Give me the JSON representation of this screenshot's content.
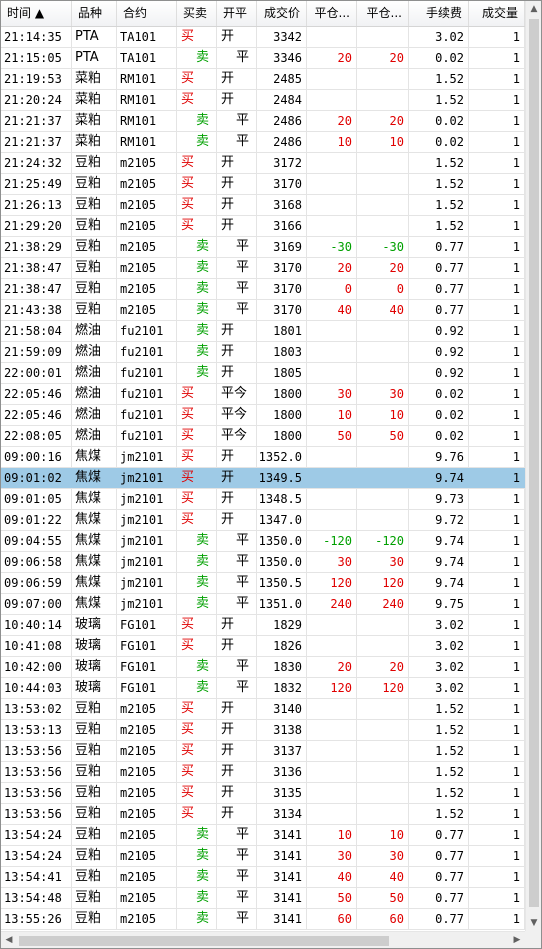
{
  "columns": [
    {
      "key": "time",
      "label": "时间 ▲"
    },
    {
      "key": "variety",
      "label": "品种"
    },
    {
      "key": "contract",
      "label": "合约"
    },
    {
      "key": "side",
      "label": "买卖"
    },
    {
      "key": "offset",
      "label": "开平"
    },
    {
      "key": "price",
      "label": "成交价"
    },
    {
      "key": "pnl1",
      "label": "平仓..."
    },
    {
      "key": "pnl2",
      "label": "平仓..."
    },
    {
      "key": "fee",
      "label": "手续费"
    },
    {
      "key": "qty",
      "label": "成交量"
    }
  ],
  "colors": {
    "buy": "#e00000",
    "sell": "#00a000",
    "selected_row": "#9ecae6"
  },
  "selected_index": 21,
  "rows": [
    {
      "time": "21:14:35",
      "variety": "PTA",
      "contract": "TA101",
      "side": "买",
      "offset": "开",
      "price": "3342",
      "pnl1": "",
      "pnl2": "",
      "fee": "3.02",
      "qty": "1"
    },
    {
      "time": "21:15:05",
      "variety": "PTA",
      "contract": "TA101",
      "side": "卖",
      "offset": "平",
      "price": "3346",
      "pnl1": "20",
      "pnl2": "20",
      "fee": "0.02",
      "qty": "1"
    },
    {
      "time": "21:19:53",
      "variety": "菜粕",
      "contract": "RM101",
      "side": "买",
      "offset": "开",
      "price": "2485",
      "pnl1": "",
      "pnl2": "",
      "fee": "1.52",
      "qty": "1"
    },
    {
      "time": "21:20:24",
      "variety": "菜粕",
      "contract": "RM101",
      "side": "买",
      "offset": "开",
      "price": "2484",
      "pnl1": "",
      "pnl2": "",
      "fee": "1.52",
      "qty": "1"
    },
    {
      "time": "21:21:37",
      "variety": "菜粕",
      "contract": "RM101",
      "side": "卖",
      "offset": "平",
      "price": "2486",
      "pnl1": "20",
      "pnl2": "20",
      "fee": "0.02",
      "qty": "1"
    },
    {
      "time": "21:21:37",
      "variety": "菜粕",
      "contract": "RM101",
      "side": "卖",
      "offset": "平",
      "price": "2486",
      "pnl1": "10",
      "pnl2": "10",
      "fee": "0.02",
      "qty": "1"
    },
    {
      "time": "21:24:32",
      "variety": "豆粕",
      "contract": "m2105",
      "side": "买",
      "offset": "开",
      "price": "3172",
      "pnl1": "",
      "pnl2": "",
      "fee": "1.52",
      "qty": "1"
    },
    {
      "time": "21:25:49",
      "variety": "豆粕",
      "contract": "m2105",
      "side": "买",
      "offset": "开",
      "price": "3170",
      "pnl1": "",
      "pnl2": "",
      "fee": "1.52",
      "qty": "1"
    },
    {
      "time": "21:26:13",
      "variety": "豆粕",
      "contract": "m2105",
      "side": "买",
      "offset": "开",
      "price": "3168",
      "pnl1": "",
      "pnl2": "",
      "fee": "1.52",
      "qty": "1"
    },
    {
      "time": "21:29:20",
      "variety": "豆粕",
      "contract": "m2105",
      "side": "买",
      "offset": "开",
      "price": "3166",
      "pnl1": "",
      "pnl2": "",
      "fee": "1.52",
      "qty": "1"
    },
    {
      "time": "21:38:29",
      "variety": "豆粕",
      "contract": "m2105",
      "side": "卖",
      "offset": "平",
      "price": "3169",
      "pnl1": "-30",
      "pnl2": "-30",
      "fee": "0.77",
      "qty": "1"
    },
    {
      "time": "21:38:47",
      "variety": "豆粕",
      "contract": "m2105",
      "side": "卖",
      "offset": "平",
      "price": "3170",
      "pnl1": "20",
      "pnl2": "20",
      "fee": "0.77",
      "qty": "1"
    },
    {
      "time": "21:38:47",
      "variety": "豆粕",
      "contract": "m2105",
      "side": "卖",
      "offset": "平",
      "price": "3170",
      "pnl1": "0",
      "pnl2": "0",
      "fee": "0.77",
      "qty": "1"
    },
    {
      "time": "21:43:38",
      "variety": "豆粕",
      "contract": "m2105",
      "side": "卖",
      "offset": "平",
      "price": "3170",
      "pnl1": "40",
      "pnl2": "40",
      "fee": "0.77",
      "qty": "1"
    },
    {
      "time": "21:58:04",
      "variety": "燃油",
      "contract": "fu2101",
      "side": "卖",
      "offset": "开",
      "price": "1801",
      "pnl1": "",
      "pnl2": "",
      "fee": "0.92",
      "qty": "1"
    },
    {
      "time": "21:59:09",
      "variety": "燃油",
      "contract": "fu2101",
      "side": "卖",
      "offset": "开",
      "price": "1803",
      "pnl1": "",
      "pnl2": "",
      "fee": "0.92",
      "qty": "1"
    },
    {
      "time": "22:00:01",
      "variety": "燃油",
      "contract": "fu2101",
      "side": "卖",
      "offset": "开",
      "price": "1805",
      "pnl1": "",
      "pnl2": "",
      "fee": "0.92",
      "qty": "1"
    },
    {
      "time": "22:05:46",
      "variety": "燃油",
      "contract": "fu2101",
      "side": "买",
      "offset": "平今",
      "price": "1800",
      "pnl1": "30",
      "pnl2": "30",
      "fee": "0.02",
      "qty": "1"
    },
    {
      "time": "22:05:46",
      "variety": "燃油",
      "contract": "fu2101",
      "side": "买",
      "offset": "平今",
      "price": "1800",
      "pnl1": "10",
      "pnl2": "10",
      "fee": "0.02",
      "qty": "1"
    },
    {
      "time": "22:08:05",
      "variety": "燃油",
      "contract": "fu2101",
      "side": "买",
      "offset": "平今",
      "price": "1800",
      "pnl1": "50",
      "pnl2": "50",
      "fee": "0.02",
      "qty": "1"
    },
    {
      "time": "09:00:16",
      "variety": "焦煤",
      "contract": "jm2101",
      "side": "买",
      "offset": "开",
      "price": "1352.0",
      "pnl1": "",
      "pnl2": "",
      "fee": "9.76",
      "qty": "1"
    },
    {
      "time": "09:01:02",
      "variety": "焦煤",
      "contract": "jm2101",
      "side": "买",
      "offset": "开",
      "price": "1349.5",
      "pnl1": "",
      "pnl2": "",
      "fee": "9.74",
      "qty": "1"
    },
    {
      "time": "09:01:05",
      "variety": "焦煤",
      "contract": "jm2101",
      "side": "买",
      "offset": "开",
      "price": "1348.5",
      "pnl1": "",
      "pnl2": "",
      "fee": "9.73",
      "qty": "1"
    },
    {
      "time": "09:01:22",
      "variety": "焦煤",
      "contract": "jm2101",
      "side": "买",
      "offset": "开",
      "price": "1347.0",
      "pnl1": "",
      "pnl2": "",
      "fee": "9.72",
      "qty": "1"
    },
    {
      "time": "09:04:55",
      "variety": "焦煤",
      "contract": "jm2101",
      "side": "卖",
      "offset": "平",
      "price": "1350.0",
      "pnl1": "-120",
      "pnl2": "-120",
      "fee": "9.74",
      "qty": "1"
    },
    {
      "time": "09:06:58",
      "variety": "焦煤",
      "contract": "jm2101",
      "side": "卖",
      "offset": "平",
      "price": "1350.0",
      "pnl1": "30",
      "pnl2": "30",
      "fee": "9.74",
      "qty": "1"
    },
    {
      "time": "09:06:59",
      "variety": "焦煤",
      "contract": "jm2101",
      "side": "卖",
      "offset": "平",
      "price": "1350.5",
      "pnl1": "120",
      "pnl2": "120",
      "fee": "9.74",
      "qty": "1"
    },
    {
      "time": "09:07:00",
      "variety": "焦煤",
      "contract": "jm2101",
      "side": "卖",
      "offset": "平",
      "price": "1351.0",
      "pnl1": "240",
      "pnl2": "240",
      "fee": "9.75",
      "qty": "1"
    },
    {
      "time": "10:40:14",
      "variety": "玻璃",
      "contract": "FG101",
      "side": "买",
      "offset": "开",
      "price": "1829",
      "pnl1": "",
      "pnl2": "",
      "fee": "3.02",
      "qty": "1"
    },
    {
      "time": "10:41:08",
      "variety": "玻璃",
      "contract": "FG101",
      "side": "买",
      "offset": "开",
      "price": "1826",
      "pnl1": "",
      "pnl2": "",
      "fee": "3.02",
      "qty": "1"
    },
    {
      "time": "10:42:00",
      "variety": "玻璃",
      "contract": "FG101",
      "side": "卖",
      "offset": "平",
      "price": "1830",
      "pnl1": "20",
      "pnl2": "20",
      "fee": "3.02",
      "qty": "1"
    },
    {
      "time": "10:44:03",
      "variety": "玻璃",
      "contract": "FG101",
      "side": "卖",
      "offset": "平",
      "price": "1832",
      "pnl1": "120",
      "pnl2": "120",
      "fee": "3.02",
      "qty": "1"
    },
    {
      "time": "13:53:02",
      "variety": "豆粕",
      "contract": "m2105",
      "side": "买",
      "offset": "开",
      "price": "3140",
      "pnl1": "",
      "pnl2": "",
      "fee": "1.52",
      "qty": "1"
    },
    {
      "time": "13:53:13",
      "variety": "豆粕",
      "contract": "m2105",
      "side": "买",
      "offset": "开",
      "price": "3138",
      "pnl1": "",
      "pnl2": "",
      "fee": "1.52",
      "qty": "1"
    },
    {
      "time": "13:53:56",
      "variety": "豆粕",
      "contract": "m2105",
      "side": "买",
      "offset": "开",
      "price": "3137",
      "pnl1": "",
      "pnl2": "",
      "fee": "1.52",
      "qty": "1"
    },
    {
      "time": "13:53:56",
      "variety": "豆粕",
      "contract": "m2105",
      "side": "买",
      "offset": "开",
      "price": "3136",
      "pnl1": "",
      "pnl2": "",
      "fee": "1.52",
      "qty": "1"
    },
    {
      "time": "13:53:56",
      "variety": "豆粕",
      "contract": "m2105",
      "side": "买",
      "offset": "开",
      "price": "3135",
      "pnl1": "",
      "pnl2": "",
      "fee": "1.52",
      "qty": "1"
    },
    {
      "time": "13:53:56",
      "variety": "豆粕",
      "contract": "m2105",
      "side": "买",
      "offset": "开",
      "price": "3134",
      "pnl1": "",
      "pnl2": "",
      "fee": "1.52",
      "qty": "1"
    },
    {
      "time": "13:54:24",
      "variety": "豆粕",
      "contract": "m2105",
      "side": "卖",
      "offset": "平",
      "price": "3141",
      "pnl1": "10",
      "pnl2": "10",
      "fee": "0.77",
      "qty": "1"
    },
    {
      "time": "13:54:24",
      "variety": "豆粕",
      "contract": "m2105",
      "side": "卖",
      "offset": "平",
      "price": "3141",
      "pnl1": "30",
      "pnl2": "30",
      "fee": "0.77",
      "qty": "1"
    },
    {
      "time": "13:54:41",
      "variety": "豆粕",
      "contract": "m2105",
      "side": "卖",
      "offset": "平",
      "price": "3141",
      "pnl1": "40",
      "pnl2": "40",
      "fee": "0.77",
      "qty": "1"
    },
    {
      "time": "13:54:48",
      "variety": "豆粕",
      "contract": "m2105",
      "side": "卖",
      "offset": "平",
      "price": "3141",
      "pnl1": "50",
      "pnl2": "50",
      "fee": "0.77",
      "qty": "1"
    },
    {
      "time": "13:55:26",
      "variety": "豆粕",
      "contract": "m2105",
      "side": "卖",
      "offset": "平",
      "price": "3141",
      "pnl1": "60",
      "pnl2": "60",
      "fee": "0.77",
      "qty": "1"
    }
  ],
  "scrollbar": {
    "up": "▲",
    "down": "▼",
    "left": "◀",
    "right": "▶"
  }
}
